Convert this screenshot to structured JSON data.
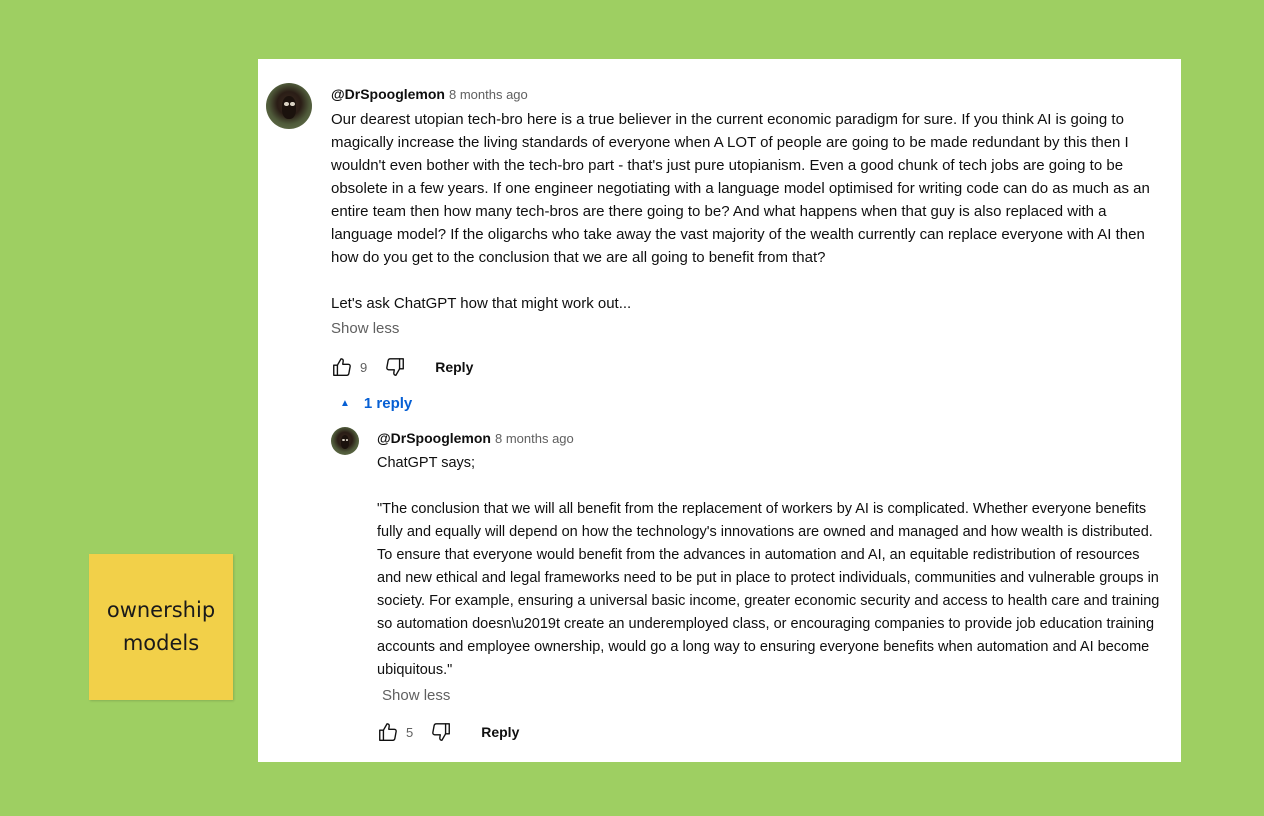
{
  "sticky_note": {
    "text": "ownership\nmodels"
  },
  "comment": {
    "handle": "@DrSpooglemon",
    "time": "8 months ago",
    "text": "Our dearest utopian tech-bro here is a true believer in the current economic paradigm for sure. If you think AI is going to magically increase the living standards of everyone when A LOT of people are going to be made redundant by this then I wouldn't even bother with the tech-bro part - that's just pure utopianism. Even a good chunk of tech jobs are going to be obsolete in a few years. If one engineer negotiating with a language model optimised for writing code can do as much as an entire team then how many tech-bros are there going to be? And what happens when that guy is also replaced with a language model? If the oligarchs who take away the vast majority of the wealth currently can replace everyone with AI then how do you get to the conclusion that we are all going to benefit from that?\n\nLet's ask ChatGPT how that might work out...",
    "show_less": "Show less",
    "likes": "9",
    "reply_label": "Reply"
  },
  "replies_toggle": {
    "label": "1 reply"
  },
  "reply": {
    "handle": "@DrSpooglemon",
    "time": "8 months ago",
    "text": "ChatGPT says;\n\n\"The conclusion that we will all benefit from the replacement of workers by AI is complicated. Whether everyone benefits fully and equally will depend on how the technology's innovations are owned and managed and how wealth is distributed. To ensure that everyone would benefit from the advances in automation and AI, an equitable redistribution of resources and new ethical and legal frameworks need to be put in place to protect individuals, communities and vulnerable groups in society. For example, ensuring a universal basic income, greater economic security and access to health care and training so automation doesn\\u2019t create an underemployed class, or encouraging companies to provide job education training accounts and employee ownership, would go a long way to ensuring everyone benefits when automation and AI become ubiquitous.\"",
    "show_less": "Show less",
    "likes": "5",
    "reply_label": "Reply"
  },
  "icons": {
    "like": "thumbs-up-icon",
    "dislike": "thumbs-down-icon",
    "caret": "caret-up-icon"
  },
  "colors": {
    "background": "#9ecf62",
    "card": "#ffffff",
    "link": "#065fd4",
    "sticky": "#f2d049"
  }
}
